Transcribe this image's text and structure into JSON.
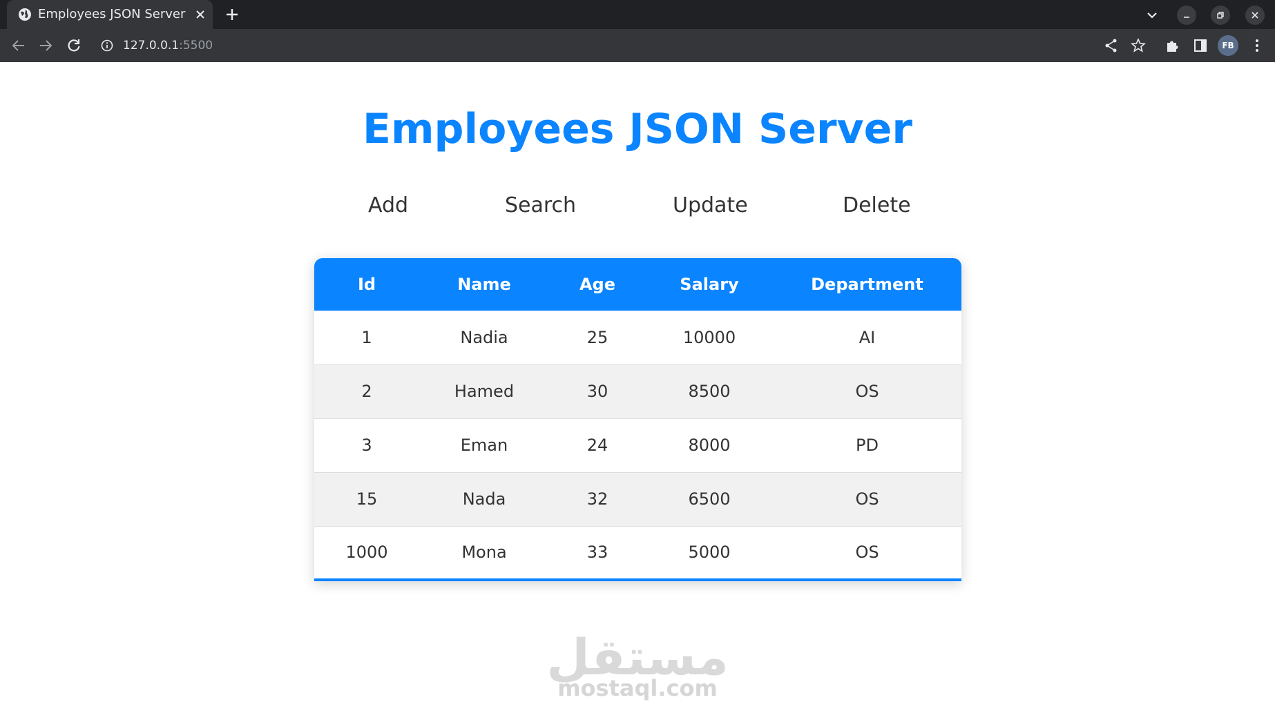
{
  "browser": {
    "tab_title": "Employees JSON Server",
    "url_host": "127.0.0.1",
    "url_port": ":5500",
    "profile_initials": "FB"
  },
  "page": {
    "heading": "Employees JSON Server",
    "nav": {
      "add": "Add",
      "search": "Search",
      "update": "Update",
      "delete": "Delete"
    },
    "table": {
      "headers": [
        "Id",
        "Name",
        "Age",
        "Salary",
        "Department"
      ],
      "rows": [
        [
          "1",
          "Nadia",
          "25",
          "10000",
          "AI"
        ],
        [
          "2",
          "Hamed",
          "30",
          "8500",
          "OS"
        ],
        [
          "3",
          "Eman",
          "24",
          "8000",
          "PD"
        ],
        [
          "15",
          "Nada",
          "32",
          "6500",
          "OS"
        ],
        [
          "1000",
          "Mona",
          "33",
          "5000",
          "OS"
        ]
      ]
    },
    "watermark": {
      "arabic": "مستقل",
      "latin": "mostaql.com"
    }
  },
  "colors": {
    "accent": "#0a84ff",
    "chrome_dark": "#202124",
    "chrome_toolbar": "#35363a"
  }
}
